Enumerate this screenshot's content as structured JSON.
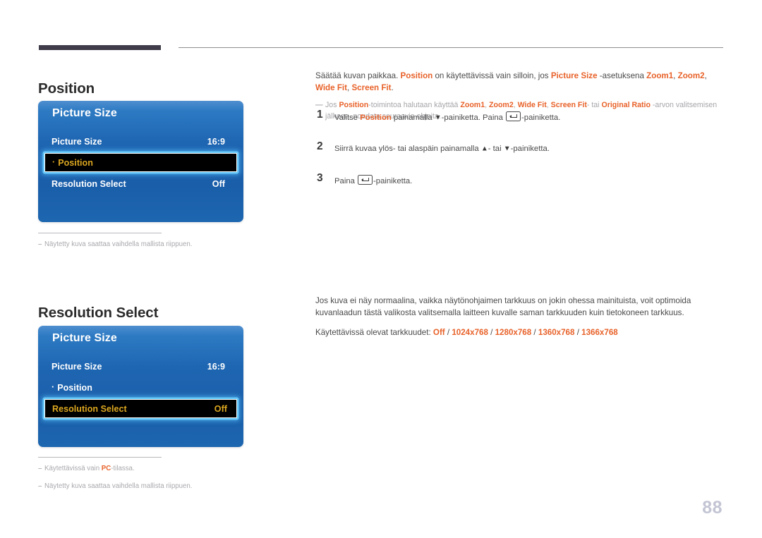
{
  "page": {
    "number": "88"
  },
  "sections": [
    {
      "id": "position",
      "heading": "Position",
      "lead": {
        "pre": "Säätää kuvan paikkaa. ",
        "hl1": "Position",
        "mid1": " on käytettävissä vain silloin, jos ",
        "hl2": "Picture Size",
        "mid2": " -asetuksena ",
        "hl3": "Zoom1",
        "sep1": ", ",
        "hl4": "Zoom2",
        "sep2": ", ",
        "hl5": "Wide Fit",
        "sep3": ", ",
        "hl6": "Screen Fit",
        "end": "."
      },
      "note": {
        "pre": "Jos ",
        "hl1": "Position",
        "mid1": "-toimintoa halutaan käyttää ",
        "hl2": "Zoom1",
        "sep1": ", ",
        "hl3": "Zoom2",
        "sep2": ", ",
        "hl4": "Wide Fit",
        "sep3": ", ",
        "hl5": "Screen Fit",
        "mid2": "- tai ",
        "hl6": "Original Ratio",
        "end": " -arvon valitsemisen jälkeen, noudata seuraavia ohjeita."
      },
      "steps": [
        {
          "num": "1",
          "a": "Valitse ",
          "hl": "Position",
          "b": " painamalla ",
          "arrow1": "▼",
          "c": "-painiketta. Paina ",
          "icon": "enter-key-icon",
          "d": "-painiketta."
        },
        {
          "num": "2",
          "a": "Siirrä kuvaa ylös- tai alaspäin painamalla ",
          "arrow1": "▲",
          "b": "- tai ",
          "arrow2": "▼",
          "c": "-painiketta."
        },
        {
          "num": "3",
          "a": "Paina ",
          "icon": "enter-key-icon",
          "b": "-painiketta."
        }
      ],
      "osd": {
        "title": "Picture Size",
        "rows": [
          {
            "label": "Picture Size",
            "value": "16:9",
            "bullet": "",
            "selected": false
          },
          {
            "label": "Position",
            "value": "",
            "bullet": "·",
            "selected": true
          },
          {
            "label": "Resolution Select",
            "value": "Off",
            "bullet": "",
            "selected": false
          }
        ]
      },
      "footnotes": [
        {
          "text": "Näytetty kuva saattaa vaihdella mallista riippuen.",
          "hl": ""
        }
      ]
    },
    {
      "id": "resolution",
      "heading": "Resolution Select",
      "lead_plain": "Jos kuva ei näy normaalina, vaikka näytönohjaimen tarkkuus on jokin ohessa mainituista, voit optimoida kuvanlaadun tästä valikosta valitsemalla laitteen kuvalle saman tarkkuuden kuin tietokoneen tarkkuus.",
      "reslist": {
        "prefix": "Käytettävissä olevat tarkkuudet: ",
        "options": [
          "Off",
          "1024x768",
          "1280x768",
          "1360x768",
          "1366x768"
        ],
        "separator": " / "
      },
      "osd": {
        "title": "Picture Size",
        "rows": [
          {
            "label": "Picture Size",
            "value": "16:9",
            "bullet": "",
            "selected": false
          },
          {
            "label": "Position",
            "value": "",
            "bullet": "·",
            "selected": false
          },
          {
            "label": "Resolution Select",
            "value": "Off",
            "bullet": "",
            "selected": true
          }
        ]
      },
      "footnotes": [
        {
          "pre": "Käytettävissä vain ",
          "hl": "PC",
          "post": "-tilassa."
        },
        {
          "pre": "Näytetty kuva saattaa vaihdella mallista riippuen.",
          "hl": "",
          "post": ""
        }
      ]
    }
  ],
  "colors": {
    "accent_orange": "#e8622a",
    "osd_blue": "#1d66b0",
    "osd_highlight_text": "#dca720",
    "osd_glow": "#6ed2ff",
    "rule_dark": "#403c49",
    "page_number": "#c3c5d4"
  }
}
